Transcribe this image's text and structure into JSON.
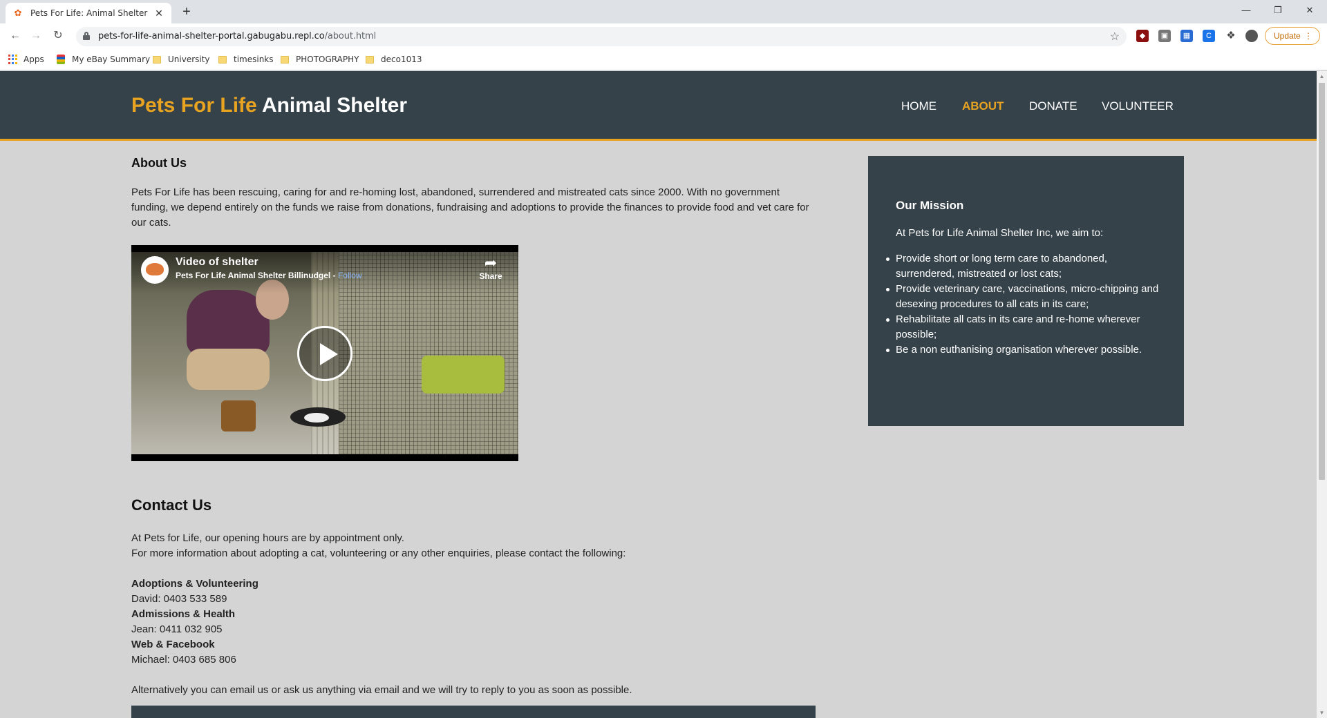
{
  "browser": {
    "tab_title": "Pets For Life: Animal Shelter | About",
    "url_host": "pets-for-life-animal-shelter-portal.gabugabu.repl.co",
    "url_path": "/about.html",
    "update_label": "Update",
    "bookmarks": [
      "Apps",
      "My eBay Summary",
      "University",
      "timesinks",
      "PHOTOGRAPHY",
      "deco1013"
    ]
  },
  "header": {
    "logo_highlight": "Pets For Life",
    "logo_rest": "Animal Shelter",
    "nav": [
      "HOME",
      "ABOUT",
      "DONATE",
      "VOLUNTEER"
    ],
    "active_nav": "ABOUT"
  },
  "about": {
    "heading": "About Us",
    "paragraph": "Pets For Life has been rescuing, caring for and re-homing lost, abandoned, surrendered and mistreated cats since 2000. With no government funding, we depend entirely on the funds we raise from donations, fundraising and adoptions to provide the finances to provide food and vet care for our cats."
  },
  "video": {
    "title": "Video of shelter",
    "channel": "Pets For Life Animal Shelter Billinudgel",
    "follow": "Follow",
    "share": "Share"
  },
  "contact": {
    "heading": "Contact Us",
    "intro1": "At Pets for Life, our opening hours are by appointment only.",
    "intro2": "For more information about adopting a cat, volunteering or any other enquiries, please contact the following:",
    "groups": [
      {
        "title": "Adoptions & Volunteering",
        "person": "David: 0403 533 589"
      },
      {
        "title": "Admissions & Health",
        "person": "Jean: 0411 032 905"
      },
      {
        "title": "Web & Facebook",
        "person": "Michael: 0403 685 806"
      }
    ],
    "outro": "Alternatively you can email us or ask us anything via email and we will try to reply to you as soon as possible."
  },
  "mission": {
    "title": "Our Mission",
    "intro": "At Pets for Life Animal Shelter Inc, we aim to:",
    "items": [
      "Provide short or long term care to abandoned, surrendered, mistreated or lost cats;",
      "Provide veterinary care, vaccinations, micro-chipping and desexing procedures to all cats in its care;",
      "Rehabilitate all cats in its care and re-home wherever possible;",
      "Be a non euthanising organisation wherever possible."
    ]
  },
  "colors": {
    "header_bg": "#35424a",
    "accent": "#e8a321",
    "page_bg": "#d4d4d4"
  }
}
